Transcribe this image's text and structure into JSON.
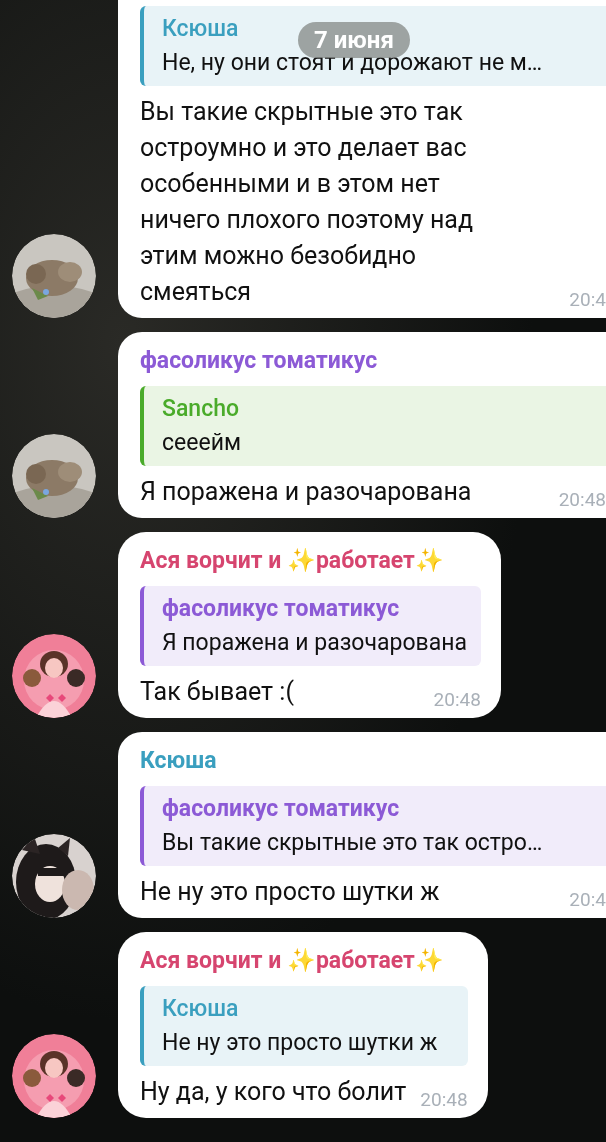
{
  "date_badge": "7 июня",
  "messages": [
    {
      "reply": {
        "author": "Ксюша",
        "color": "#3a9fbf",
        "text": "Не, ну они стоят и дорожают не м…"
      },
      "text": "Вы такие скрытные это так остроумно и это делает вас особенными и в этом нет ничего плохого поэтому над этим можно безобидно смеяться",
      "time": "20:4",
      "wide": true
    },
    {
      "sender": {
        "name": "фасоликус томатикус",
        "color": "#8c5ad6"
      },
      "reply": {
        "author": "Sancho",
        "color": "#4aab2a",
        "text": "сееейм"
      },
      "text": "Я поражена и разочарована",
      "time": "20:48",
      "wide": true
    },
    {
      "sender": {
        "name": "Ася ворчит и ✨работает✨",
        "color": "#d6456f"
      },
      "reply": {
        "author": "фасоликус томатикус",
        "color": "#8c5ad6",
        "text": "Я поражена и разочарована"
      },
      "text": "Так бывает :(",
      "time": "20:48",
      "wide": false
    },
    {
      "sender": {
        "name": "Ксюша",
        "color": "#3a9fbf"
      },
      "reply": {
        "author": "фасоликус томатикус",
        "color": "#8c5ad6",
        "text": "Вы такие скрытные это так остро…"
      },
      "text": "Не ну это просто шутки ж",
      "time": "20:4",
      "wide": true
    },
    {
      "sender": {
        "name": "Ася ворчит и ✨работает✨",
        "color": "#d6456f"
      },
      "reply": {
        "author": "Ксюша",
        "color": "#3a9fbf",
        "text": "Не ну это просто шутки ж"
      },
      "text": "Ну да, у кого что болит",
      "time": "20:48",
      "wide": false
    }
  ]
}
